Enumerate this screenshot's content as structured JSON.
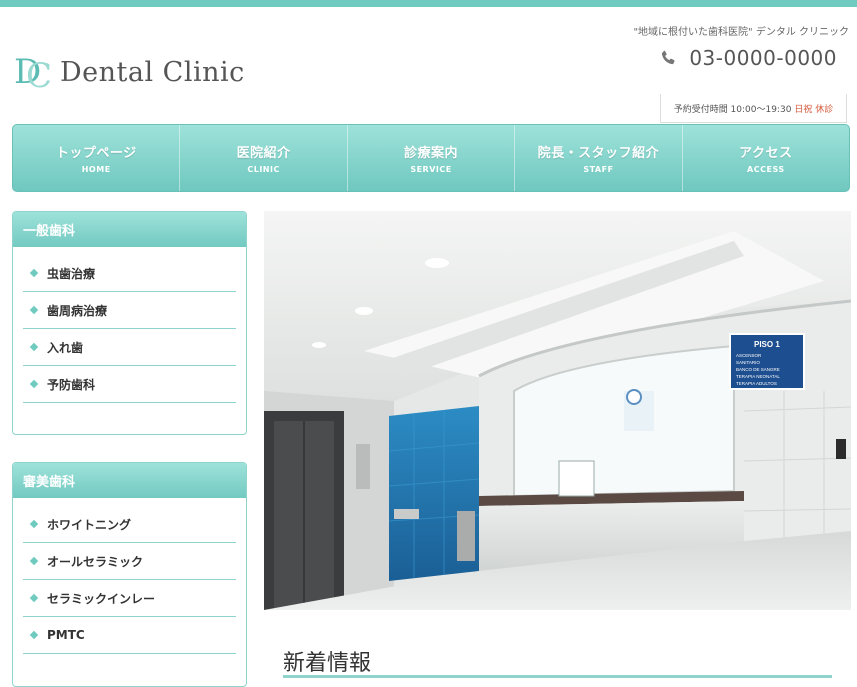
{
  "header": {
    "logo_text": "Dental Clinic",
    "logo_letters": {
      "d": "D",
      "c": "C"
    },
    "tagline": "\"地域に根付いた歯科医院\" デンタル クリニック",
    "phone": "03-0000-0000",
    "hours_label": "予約受付時間 10:00～19:30",
    "hours_closed": "日祝 休診"
  },
  "nav": [
    {
      "jp": "トップページ",
      "en": "HOME"
    },
    {
      "jp": "医院紹介",
      "en": "CLINIC"
    },
    {
      "jp": "診療案内",
      "en": "SERVICE"
    },
    {
      "jp": "院長・スタッフ紹介",
      "en": "STAFF"
    },
    {
      "jp": "アクセス",
      "en": "ACCESS"
    }
  ],
  "sidebar": {
    "general": {
      "title": "一般歯科",
      "items": [
        "虫歯治療",
        "歯周病治療",
        "入れ歯",
        "予防歯科"
      ]
    },
    "cosmetic": {
      "title": "審美歯科",
      "items": [
        "ホワイトニング",
        "オールセラミック",
        "セラミックインレー",
        "PMTC"
      ]
    }
  },
  "hero": {
    "sign_title": "PISO 1",
    "sign_lines": [
      "ASCENSOR",
      "SANITARIO",
      "BANCO DE SANGRE",
      "TERAPIA NEONATAL",
      "TERAPIA ADULTOS"
    ]
  },
  "news": {
    "title": "新着情報"
  },
  "colors": {
    "accent": "#6fcac0",
    "accent_light": "#9ee2da",
    "closed": "#d35a3b"
  }
}
